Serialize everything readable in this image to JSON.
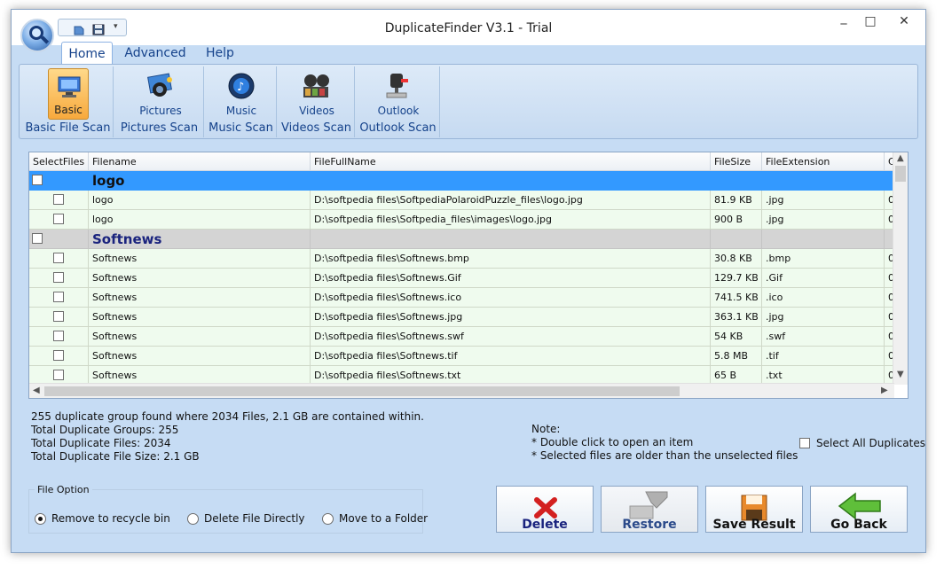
{
  "window": {
    "title": "DuplicateFinder V3.1 - Trial",
    "minimize": "_",
    "maximize": "□",
    "close": "✕"
  },
  "tabs": [
    {
      "label": "Home"
    },
    {
      "label": "Advanced"
    },
    {
      "label": "Help"
    }
  ],
  "ribbon": {
    "groups": [
      {
        "button": "Basic",
        "group": "Basic File Scan"
      },
      {
        "button": "Pictures",
        "group": "Pictures Scan"
      },
      {
        "button": "Music",
        "group": "Music Scan"
      },
      {
        "button": "Videos",
        "group": "Videos Scan"
      },
      {
        "button": "Outlook",
        "group": "Outlook Scan"
      }
    ]
  },
  "grid": {
    "columns": [
      "SelectFiles",
      "Filename",
      "FileFullName",
      "FileSize",
      "FileExtension",
      "C"
    ],
    "rows": [
      {
        "type": "group",
        "name": "logo"
      },
      {
        "type": "item",
        "filename": "logo",
        "fullname": "D:\\softpedia files\\SoftpediaPolaroidPuzzle_files\\logo.jpg",
        "size": "81.9 KB",
        "ext": ".jpg",
        "extra": "0"
      },
      {
        "type": "item",
        "filename": "logo",
        "fullname": "D:\\softpedia files\\Softpedia_files\\images\\logo.jpg",
        "size": "900 B",
        "ext": ".jpg",
        "extra": "0"
      },
      {
        "type": "group",
        "name": "Softnews"
      },
      {
        "type": "item",
        "filename": "Softnews",
        "fullname": "D:\\softpedia files\\Softnews.bmp",
        "size": "30.8 KB",
        "ext": ".bmp",
        "extra": "0"
      },
      {
        "type": "item",
        "filename": "Softnews",
        "fullname": "D:\\softpedia files\\Softnews.Gif",
        "size": "129.7 KB",
        "ext": ".Gif",
        "extra": "0"
      },
      {
        "type": "item",
        "filename": "Softnews",
        "fullname": "D:\\softpedia files\\Softnews.ico",
        "size": "741.5 KB",
        "ext": ".ico",
        "extra": "0"
      },
      {
        "type": "item",
        "filename": "Softnews",
        "fullname": "D:\\softpedia files\\Softnews.jpg",
        "size": "363.1 KB",
        "ext": ".jpg",
        "extra": "0"
      },
      {
        "type": "item",
        "filename": "Softnews",
        "fullname": "D:\\softpedia files\\Softnews.swf",
        "size": "54 KB",
        "ext": ".swf",
        "extra": "0"
      },
      {
        "type": "item",
        "filename": "Softnews",
        "fullname": "D:\\softpedia files\\Softnews.tif",
        "size": "5.8 MB",
        "ext": ".tif",
        "extra": "0"
      },
      {
        "type": "item",
        "filename": "Softnews",
        "fullname": "D:\\softpedia files\\Softnews.txt",
        "size": "65 B",
        "ext": ".txt",
        "extra": "0"
      }
    ]
  },
  "summary": {
    "line1": "255 duplicate group found where 2034 Files, 2.1 GB are contained within.",
    "line2": "Total Duplicate Groups: 255",
    "line3": "Total Duplicate Files: 2034",
    "line4": "Total Duplicate File Size: 2.1 GB"
  },
  "note": {
    "title": "Note:",
    "line1": "* Double click to open an item",
    "line2": "* Selected files are older than the unselected files"
  },
  "select_all": "Select All Duplicates",
  "file_option": {
    "legend": "File Option",
    "options": [
      "Remove to recycle bin",
      "Delete File Directly",
      "Move to a Folder"
    ],
    "selected": 0
  },
  "actions": {
    "delete": "Delete",
    "restore": "Restore",
    "save": "Save Result",
    "back": "Go Back"
  },
  "colors": {
    "group_selected": "#3399ff",
    "group": "#d4d4d4",
    "item_bg": "#effbee",
    "panel_bg": "#c6dcf4"
  }
}
